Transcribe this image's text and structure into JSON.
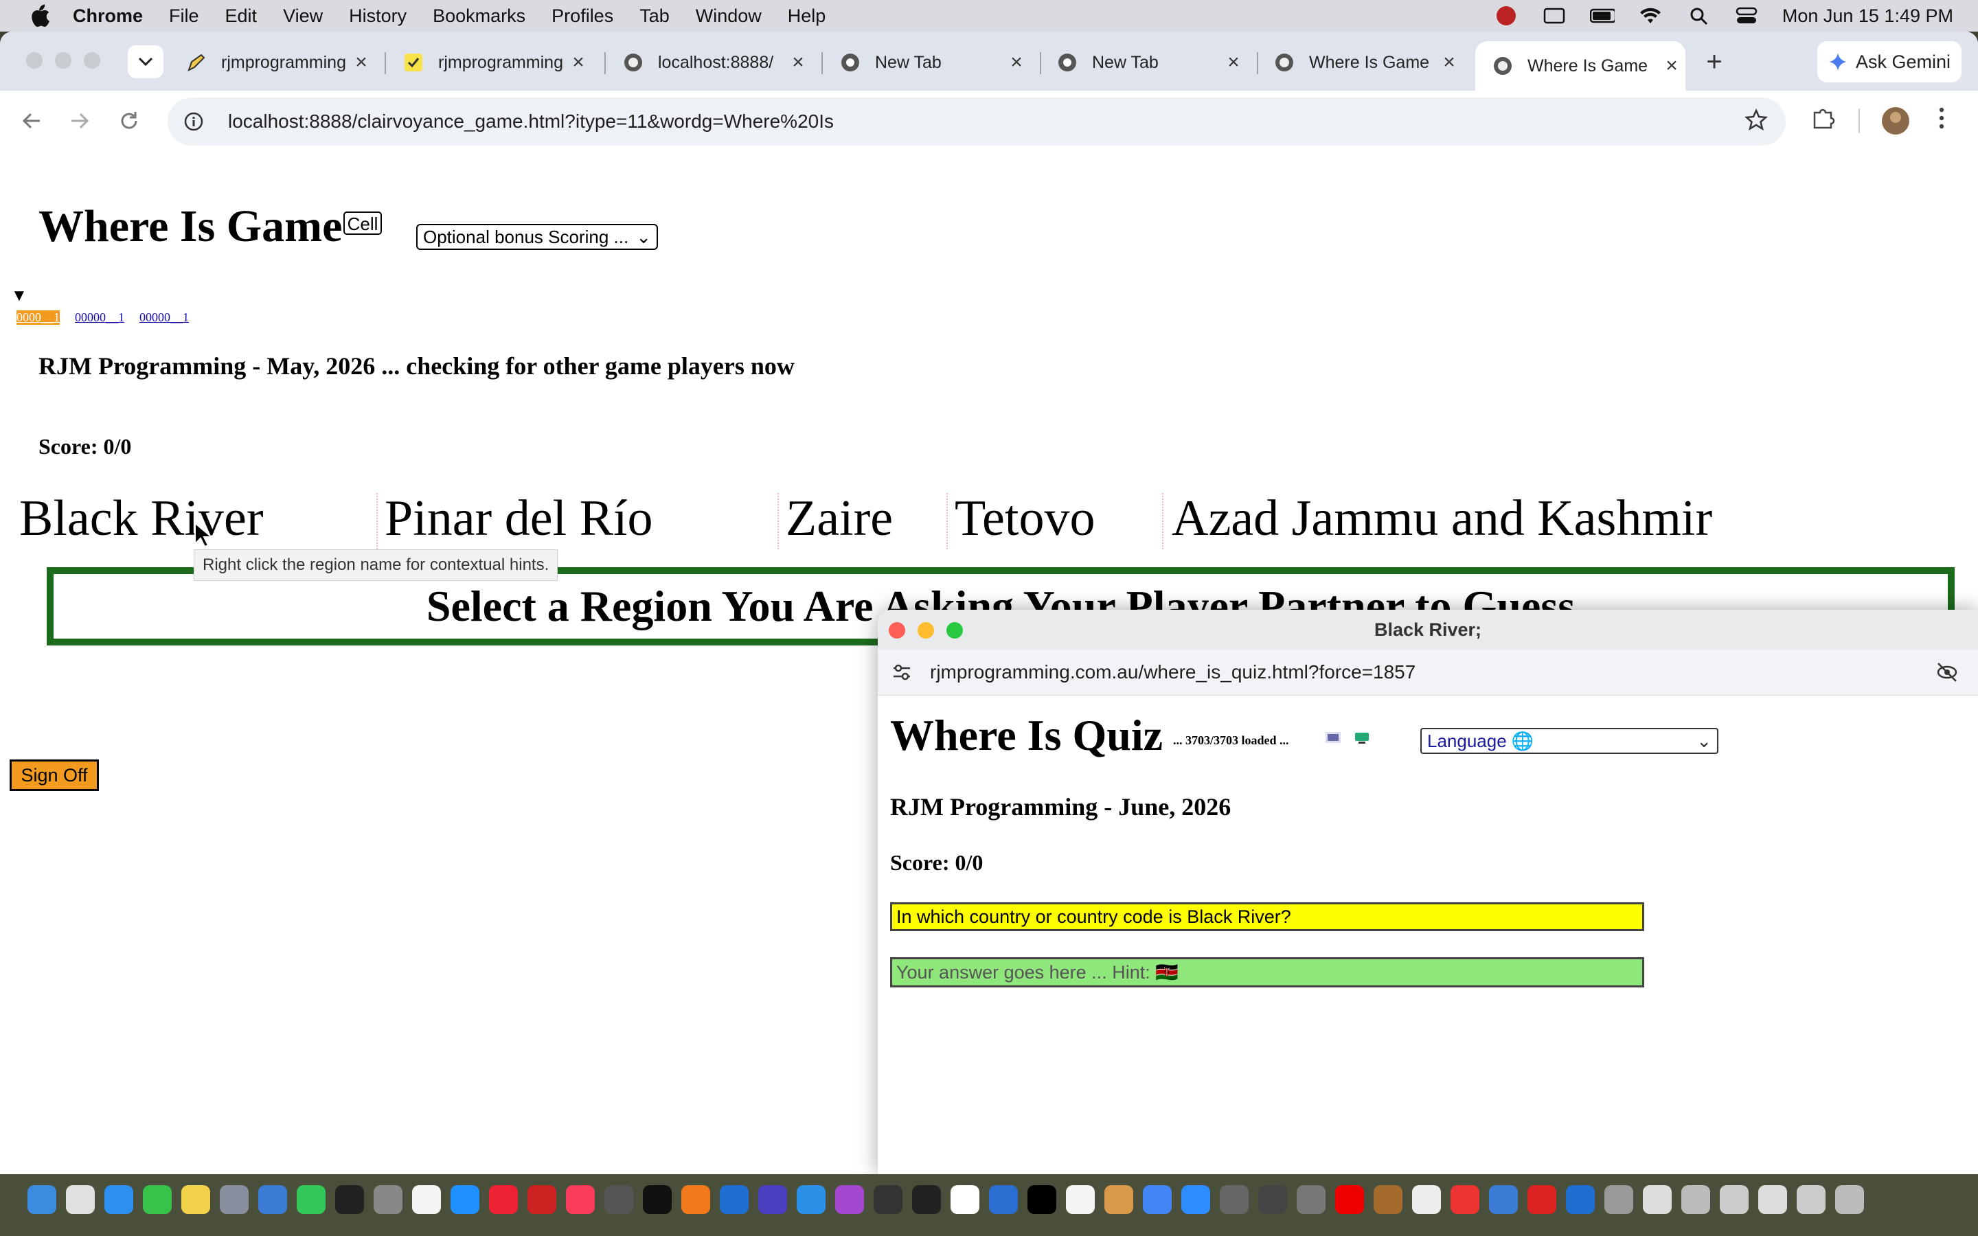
{
  "menubar": {
    "app": "Chrome",
    "items": [
      "File",
      "Edit",
      "View",
      "History",
      "Bookmarks",
      "Profiles",
      "Tab",
      "Window",
      "Help"
    ],
    "clock": "Mon Jun 15  1:49 PM"
  },
  "tabs": [
    {
      "title": "rjmprogramming",
      "icon": "pencil-icon"
    },
    {
      "title": "rjmprogramming",
      "icon": "check-icon"
    },
    {
      "title": "localhost:8888/",
      "icon": "github-icon"
    },
    {
      "title": "New Tab",
      "icon": "chrome-icon"
    },
    {
      "title": "New Tab",
      "icon": "chrome-icon"
    },
    {
      "title": "Where Is Game",
      "icon": "github-icon"
    },
    {
      "title": "Where Is Game",
      "icon": "github-icon",
      "active": true
    }
  ],
  "gemini_label": "Ask Gemini",
  "address": "localhost:8888/clairvoyance_game.html?itype=11&wordg=Where%20Is",
  "page": {
    "title": "Where Is Game",
    "cell_button": "Cell",
    "bonus_select": "Optional bonus Scoring ...",
    "disclosure": "▼",
    "links": [
      "0000__1",
      "00000__1",
      "00000__1"
    ],
    "subhead": "RJM Programming - May, 2026 ... checking for other game players now",
    "score": "Score: 0/0",
    "regions": [
      "Black River",
      "Pinar del Río",
      "Zaire",
      "Tetovo",
      "Azad Jammu and Kashmir"
    ],
    "tooltip": "Right click the region name for contextual hints.",
    "select_prompt": "Select a Region You Are Asking Your Player Partner to Guess",
    "sign_off": "Sign Off"
  },
  "popup": {
    "window_title": "Black River;",
    "url": "rjmprogramming.com.au/where_is_quiz.html?force=1857",
    "title": "Where Is Quiz",
    "loaded": "... 3703/3703 loaded ...",
    "language": "Language 🌐",
    "subhead": "RJM Programming - June, 2026",
    "score": "Score: 0/0",
    "question": "In which country or country code is Black River?",
    "answer_placeholder": "Your answer goes here ... Hint: 🇰🇪"
  },
  "colors": {
    "accent_orange": "#f29b1e",
    "select_border_green": "#1d6b1d",
    "question_yellow": "#ffff00",
    "answer_green": "#8fe67a"
  }
}
